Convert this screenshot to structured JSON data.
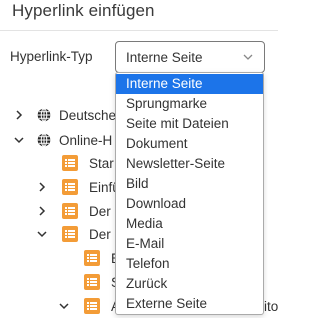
{
  "dialog": {
    "title": "Hyperlink einfügen"
  },
  "form": {
    "type_label": "Hyperlink-Typ",
    "select_value": "Interne Seite"
  },
  "tree": {
    "items": [
      {
        "label": "Deutsche",
        "icon": "globe-icon",
        "toggle": "chevron-right-icon"
      },
      {
        "label": "Online-H",
        "icon": "globe-icon",
        "toggle": "chevron-down-icon"
      },
      {
        "label": "Star",
        "icon": "page-icon",
        "toggle": ""
      },
      {
        "label": "Einfü",
        "icon": "page-icon",
        "toggle": "chevron-right-icon"
      },
      {
        "label": "Der",
        "icon": "page-icon",
        "toggle": "chevron-right-icon"
      },
      {
        "label": "Der",
        "icon": "page-icon",
        "toggle": "chevron-down-icon"
      },
      {
        "label": "E",
        "icon": "page-icon",
        "toggle": ""
      },
      {
        "label": "S",
        "icon": "page-icon",
        "toggle": ""
      },
      {
        "label": "A",
        "icon": "page-icon",
        "toggle": "chevron-down-icon",
        "suffix": "ito"
      }
    ]
  },
  "dropdown": {
    "selected_index": 0,
    "options": [
      "Interne Seite",
      "Sprungmarke",
      "Seite mit Dateien",
      "Dokument",
      "Newsletter-Seite",
      "Bild",
      "Download",
      "Media",
      "E-Mail",
      "Telefon",
      "Zurück",
      "Externe Seite"
    ]
  },
  "colors": {
    "accent": "#1c74e9",
    "page_icon": "#f39c37",
    "text": "#333333"
  }
}
